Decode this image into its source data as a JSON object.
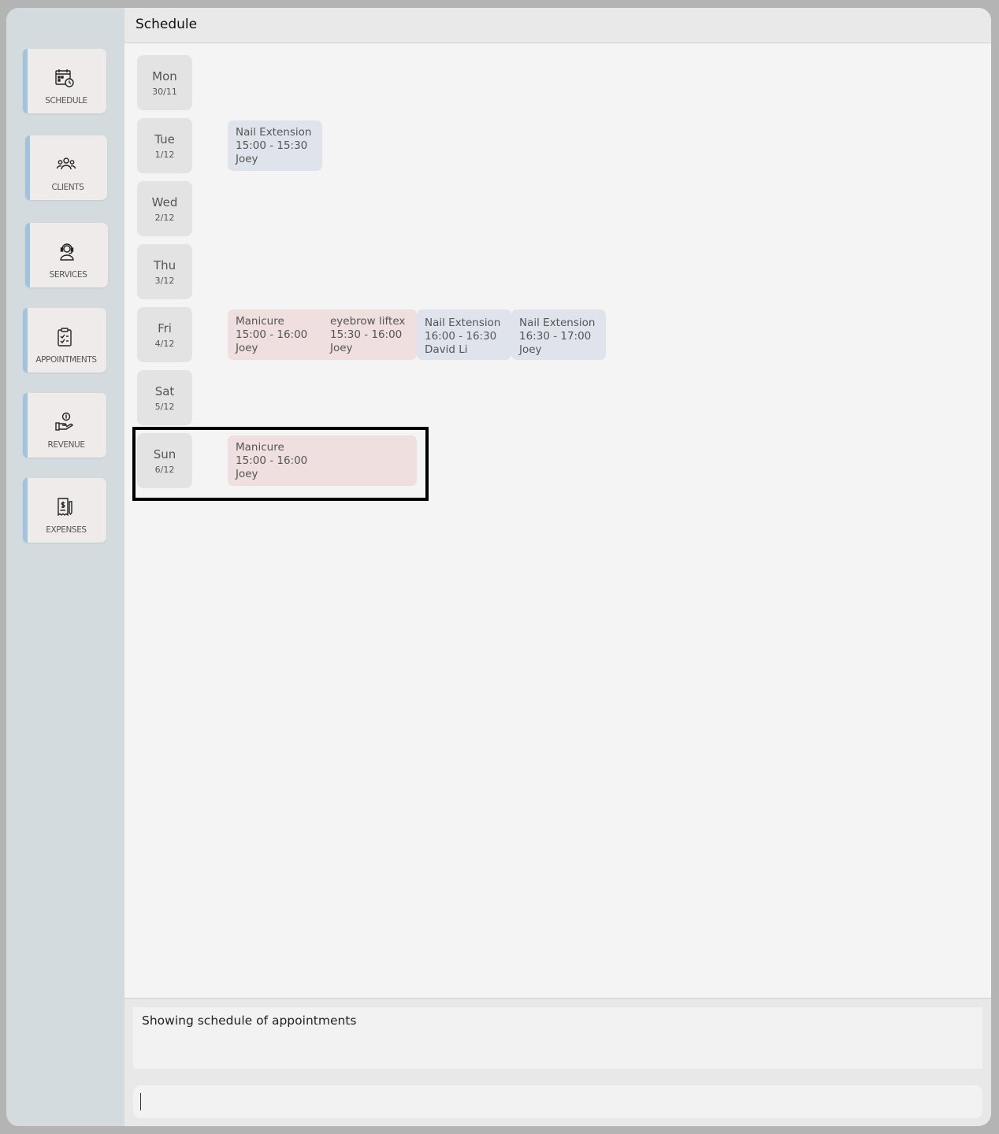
{
  "header": {
    "title": "Schedule"
  },
  "sidebar": {
    "items": [
      {
        "label": "SCHEDULE",
        "icon": "calendar-clock-icon"
      },
      {
        "label": "CLIENTS",
        "icon": "people-group-icon"
      },
      {
        "label": "SERVICES",
        "icon": "headset-person-icon"
      },
      {
        "label": "APPOINTMENTS",
        "icon": "clipboard-check-icon"
      },
      {
        "label": "REVENUE",
        "icon": "hand-coin-icon"
      },
      {
        "label": "EXPENSES",
        "icon": "receipt-dollar-icon"
      }
    ]
  },
  "days": [
    {
      "day": "Mon",
      "date": "30/11",
      "appointments": []
    },
    {
      "day": "Tue",
      "date": "1/12",
      "appointments": [
        {
          "service": "Nail Extension",
          "time": "15:00 - 15:30",
          "staff": "Joey",
          "color": "#dfe4ec"
        }
      ]
    },
    {
      "day": "Wed",
      "date": "2/12",
      "appointments": []
    },
    {
      "day": "Thu",
      "date": "3/12",
      "appointments": []
    },
    {
      "day": "Fri",
      "date": "4/12",
      "appointments": [
        {
          "service": "Manicure",
          "time": "15:00 - 16:00",
          "staff": "Joey",
          "color": "#efdfdf"
        },
        {
          "service": "eyebrow liftex",
          "time": "15:30 - 16:00",
          "staff": "Joey",
          "color": "#efdfdf"
        },
        {
          "service": "Nail Extension",
          "time": "16:00 - 16:30",
          "staff": "David Li",
          "color": "#dfe4ec"
        },
        {
          "service": "Nail Extension",
          "time": "16:30 - 17:00",
          "staff": "Joey",
          "color": "#dfe4ec"
        }
      ]
    },
    {
      "day": "Sat",
      "date": "5/12",
      "appointments": []
    },
    {
      "day": "Sun",
      "date": "6/12",
      "appointments": [
        {
          "service": "Manicure",
          "time": "15:00 - 16:00",
          "staff": "Joey",
          "color": "#efdfdf"
        }
      ]
    }
  ],
  "result": {
    "message": "Showing schedule of appointments"
  },
  "command": {
    "value": ""
  },
  "colors": {
    "sidebar_bg": "#d3dbde",
    "nav_accent": "#a3c2dd",
    "appt_blue": "#dfe4ec",
    "appt_pink": "#efdfdf",
    "panel_bg": "#f4f4f4"
  }
}
